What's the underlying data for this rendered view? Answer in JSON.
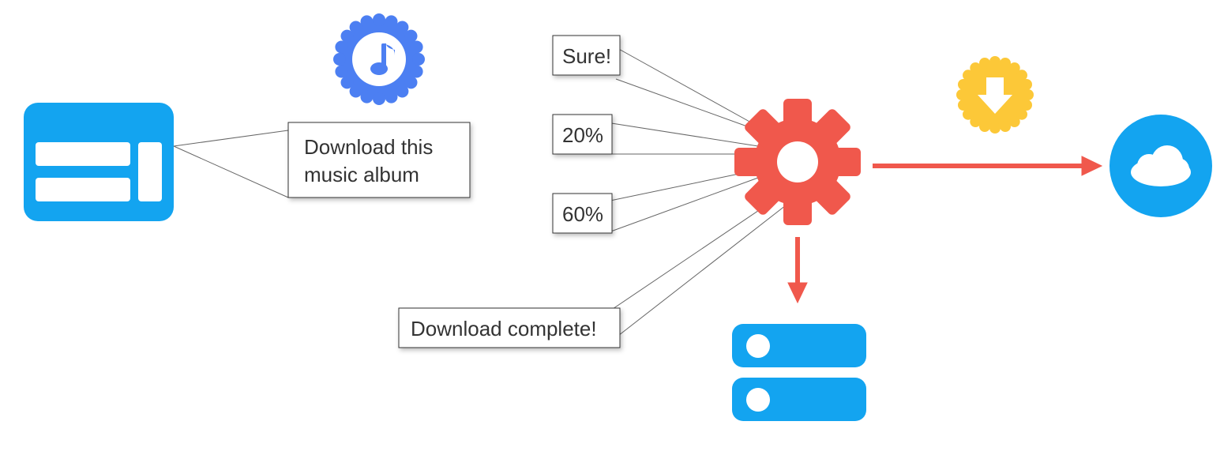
{
  "colors": {
    "blue": "#13a4f0",
    "indigo": "#4c7ff2",
    "red": "#f0584c",
    "yellow": "#fcc838"
  },
  "request_bubble": "Download this\nmusic album",
  "responses": {
    "sure": "Sure!",
    "p20": "20%",
    "p60": "60%",
    "done": "Download complete!"
  },
  "icons": {
    "client": "client-window-icon",
    "music": "music-badge-icon",
    "gear": "gear-icon",
    "download_badge": "download-badge-icon",
    "cloud": "cloud-icon",
    "storage": "storage-server-icon"
  }
}
